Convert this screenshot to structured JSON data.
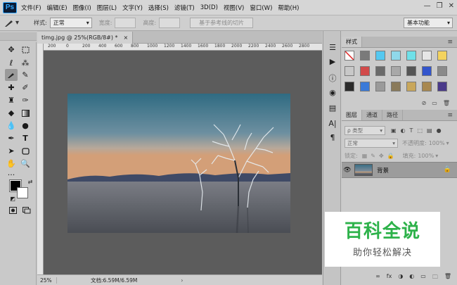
{
  "app": {
    "logo": "Ps"
  },
  "menu": {
    "items": [
      "文件(F)",
      "编辑(E)",
      "图像(I)",
      "图层(L)",
      "文字(Y)",
      "选择(S)",
      "滤镜(T)",
      "3D(D)",
      "视图(V)",
      "窗口(W)",
      "帮助(H)"
    ]
  },
  "window_controls": {
    "minimize": "—",
    "restore": "❐",
    "close": "✕"
  },
  "options": {
    "style_label": "样式:",
    "style_value": "正常",
    "width_label": "宽度:",
    "height_label": "高度:",
    "slice_button": "基于参考线的切片",
    "workspace": "基本功能"
  },
  "document": {
    "tab_title": "timg.jpg @ 25%(RGB/8#) *",
    "tab_close": "×",
    "ruler_marks": [
      "200",
      "0",
      "200",
      "400",
      "600",
      "800",
      "1000",
      "1200",
      "1400",
      "1600",
      "1800",
      "2000",
      "2200",
      "2400",
      "2600",
      "2800"
    ]
  },
  "status": {
    "zoom": "25%",
    "doc_info": "文档:6.59M/6.59M",
    "arrow": "›"
  },
  "styles_panel": {
    "tab": "样式",
    "menu_icon": "≡",
    "swatch_colors": [
      "#ffffff",
      "#7a7a7a",
      "#55c8f0",
      "#8fd8ea",
      "#6fe0e8",
      "#e6e6e6",
      "#f4d35e",
      "#c8c8c8",
      "#d24b4b",
      "#6a6a6a",
      "#a8a8a8",
      "#555555",
      "#3355cc",
      "#8a8a8a",
      "#2a2a2a",
      "#3b7ad8",
      "#9a9a9a",
      "#8a7a5a",
      "#c9a75b",
      "#a88850",
      "#4a3a8a"
    ],
    "footer_icons": [
      "⊘",
      "▭",
      "🗑"
    ]
  },
  "layers_panel": {
    "tabs": [
      "图层",
      "通道",
      "路径"
    ],
    "active_tab": "图层",
    "filter_label": "ρ 类型",
    "blend_mode": "正常",
    "opacity_label": "不透明度:",
    "opacity_value": "100%",
    "lock_label": "锁定:",
    "fill_label": "填充:",
    "fill_value": "100%",
    "layer_name": "背景",
    "footer_icons": [
      "∞",
      "fx",
      "◑",
      "◐",
      "▭",
      "🗀",
      "🗑"
    ]
  },
  "watermark": {
    "title": "百科全说",
    "subtitle": "助你轻松解决"
  }
}
